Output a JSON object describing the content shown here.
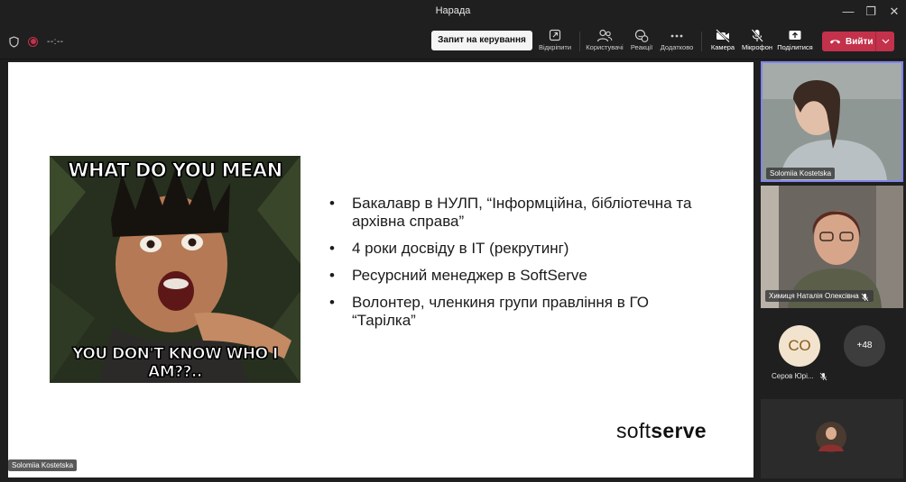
{
  "window": {
    "title": "Нарада",
    "min_glyph": "—",
    "restore_glyph": "❐",
    "close_glyph": "✕"
  },
  "toolbar": {
    "timer": "--:--",
    "request_control": "Запит на керування",
    "tools": [
      {
        "label": "Відкріпити",
        "icon": "unpin-icon"
      },
      {
        "label": "Користувачі",
        "icon": "people-icon"
      },
      {
        "label": "Реакції",
        "icon": "reactions-icon"
      },
      {
        "label": "Додатково",
        "icon": "more-icon"
      },
      {
        "label": "Камера",
        "icon": "camera-off-icon"
      },
      {
        "label": "Мікрофон",
        "icon": "mic-off-icon"
      },
      {
        "label": "Поділитися",
        "icon": "share-icon"
      }
    ],
    "leave": "Вийти"
  },
  "slide": {
    "meme_top": "WHAT DO YOU MEAN",
    "meme_bottom": "YOU DON'T KNOW WHO I AM??..",
    "bullets": [
      "Бакалавр в НУЛП, “Інформційна, бібліотечна та архівна справа”",
      "4 роки досвіду в ІТ (рекрутинг)",
      "Ресурсний менеджер в SoftServe",
      "Волонтер, членкиня групи правління в ГО “Тарілка”"
    ],
    "brand_light": "soft",
    "brand_bold": "serve",
    "presenter_name": "Solomiia Kostetska"
  },
  "participants": {
    "tile1_name": "Solomiia Kostetska",
    "tile2_name": "Химиця Наталія Олексівна",
    "co_initials": "СО",
    "co_name": "Серов Юрі...",
    "more_count": "+48"
  },
  "colors": {
    "accent": "#7f85ea",
    "leave": "#c4314b",
    "avatar_bg": "#f1e3cd",
    "avatar_text": "#8a5c1e"
  }
}
